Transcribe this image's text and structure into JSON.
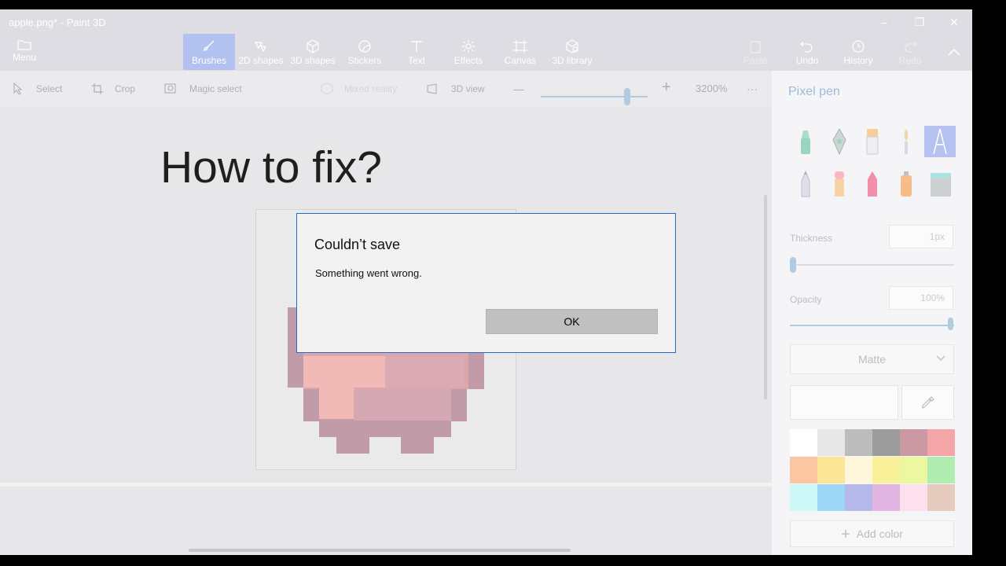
{
  "window": {
    "title": "apple.png* - Paint 3D",
    "controls": [
      "–",
      "❐",
      "✕"
    ]
  },
  "ribbon": {
    "menu_label": "Menu",
    "tabs": [
      {
        "label": "Brushes",
        "icon": "brush-icon",
        "active": true
      },
      {
        "label": "2D shapes",
        "icon": "2d-shapes-icon"
      },
      {
        "label": "3D shapes",
        "icon": "3d-shapes-icon"
      },
      {
        "label": "Stickers",
        "icon": "stickers-icon"
      },
      {
        "label": "Text",
        "icon": "text-icon"
      },
      {
        "label": "Effects",
        "icon": "effects-icon"
      },
      {
        "label": "Canvas",
        "icon": "canvas-icon"
      },
      {
        "label": "3D library",
        "icon": "3d-library-icon"
      }
    ],
    "paste_label": "Paste",
    "undo_label": "Undo",
    "history_label": "History",
    "redo_label": "Redo"
  },
  "toolbar": {
    "select_label": "Select",
    "crop_label": "Crop",
    "magic_select_label": "Magic select",
    "mixed_reality_label": "Mixed reality",
    "view_3d_label": "3D view",
    "zoom_minus": "—",
    "zoom_plus": "+",
    "zoom_level": "3200%",
    "more": "···"
  },
  "canvas": {
    "overlay_text": "How to fix?"
  },
  "dialog": {
    "title": "Couldn’t save",
    "message": "Something went wrong.",
    "ok_label": "OK"
  },
  "panel": {
    "title": "Pixel pen",
    "brushes": [
      "marker",
      "calligraphy-pen",
      "oil-brush",
      "watercolor",
      "pixel-pen",
      "pencil",
      "eraser",
      "crayon",
      "spray-can",
      "fill"
    ],
    "selected_brush": "pixel-pen",
    "thickness_label": "Thickness",
    "thickness_value": "1px",
    "opacity_label": "Opacity",
    "opacity_value": "100%",
    "finish_value": "Matte",
    "swatches": [
      "#ffffff",
      "#e4e4e4",
      "#b3b3b3",
      "#8f8f8f",
      "#c48b97",
      "#f2999d",
      "#fcbf97",
      "#fbe38a",
      "#fef6d8",
      "#f9f08c",
      "#eaf792",
      "#a5e9a6",
      "#c8f6f7",
      "#8fd3f5",
      "#acb1e9",
      "#dfacde",
      "#fcdcea",
      "#e2c4b6"
    ],
    "add_color_label": "Add color"
  },
  "colors": {
    "accent": "#1e6fc4",
    "brushes_active": "#a9b9ee",
    "panel_title": "#8fb2d6"
  }
}
